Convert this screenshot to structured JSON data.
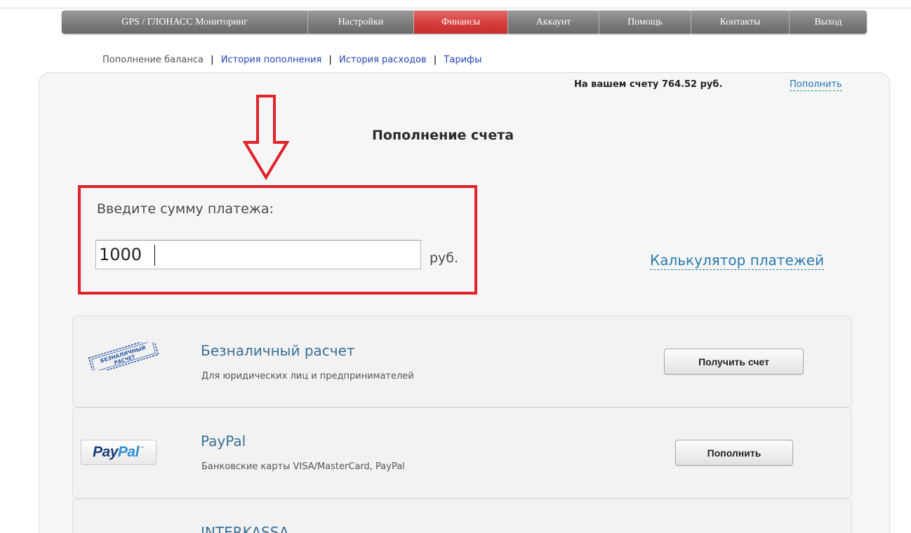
{
  "topnav": {
    "items": [
      {
        "label": "GPS / ГЛОНАСС Мониторинг",
        "active": false
      },
      {
        "label": "Настройки",
        "active": false
      },
      {
        "label": "Финансы",
        "active": true
      },
      {
        "label": "Аккаунт",
        "active": false
      },
      {
        "label": "Помощь",
        "active": false
      },
      {
        "label": "Контакты",
        "active": false
      },
      {
        "label": "Выход",
        "active": false
      }
    ],
    "active_color": "#d63c3c",
    "base_color": "#7c7c7c"
  },
  "subnav": {
    "current": "Пополнение баланса",
    "separator": "|",
    "links": [
      "История пополнения",
      "История расходов",
      "Тарифы"
    ]
  },
  "balance": {
    "text": "На вашем счету 764.52 руб.",
    "topup_link": "Пополнить"
  },
  "title": "Пополнение счета",
  "amount": {
    "label": "Введите сумму платежа:",
    "value": "1000",
    "currency": "руб."
  },
  "calculator_link": "Калькулятор платежей",
  "methods": [
    {
      "logo_text": [
        "БЕЗНАЛИЧНЫЙ",
        "РАСЧЕТ"
      ],
      "title": "Безналичный расчет",
      "description": "Для юридических лиц и предпринимателей",
      "button": "Получить счет"
    },
    {
      "logo_text": [
        "Pay",
        "Pal",
        "™"
      ],
      "title": "PayPal",
      "description": "Банковские карты VISA/MasterCard, PayPal",
      "button": "Пополнить"
    },
    {
      "title": "INTERKASSA"
    }
  ],
  "colors": {
    "highlight": "#e0222b",
    "arrow": "#e0222b",
    "link": "#1f73b8",
    "card_title": "#3b6f96"
  },
  "icons": {
    "annotation": "down-arrow-icon",
    "stamp": "cashless-stamp-icon",
    "paypal": "paypal-logo"
  }
}
